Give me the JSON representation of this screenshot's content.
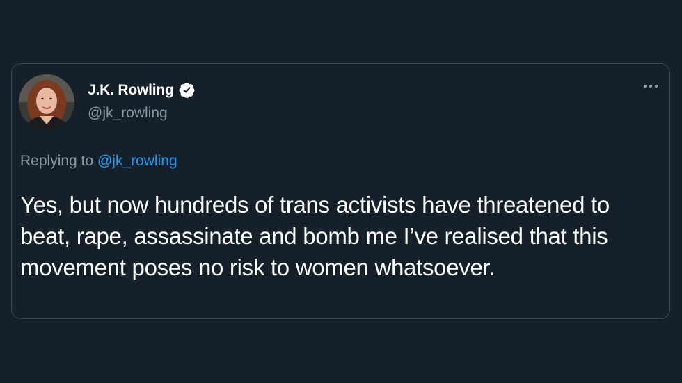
{
  "tweet": {
    "author": {
      "display_name": "J.K. Rowling",
      "handle": "@jk_rowling",
      "verified": true,
      "verified_icon": "verified-badge-icon"
    },
    "menu_icon": "more-horizontal-icon",
    "reply_context": {
      "prefix": "Replying to",
      "mention": "@jk_rowling"
    },
    "text": "Yes, but now hundreds of trans activists have threatened to beat, rape, assassinate and bomb me I’ve realised that this movement poses no risk to women whatsoever."
  },
  "colors": {
    "background": "#15202b",
    "text_primary": "#ffffff",
    "text_secondary": "#8b98a5",
    "accent_link": "#1d9bf0",
    "border": "#3a4754"
  }
}
